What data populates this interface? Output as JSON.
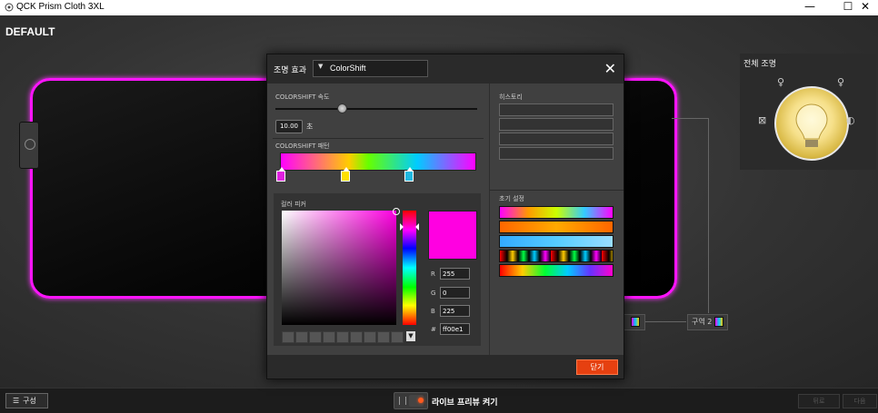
{
  "window": {
    "title": "QCK Prism Cloth 3XL",
    "minimize": "—",
    "maximize": "☐",
    "close": "✕"
  },
  "profile": {
    "name": "DEFAULT"
  },
  "global_lighting": {
    "label": "전체 조명"
  },
  "zone": {
    "label": "구역 2"
  },
  "dialog": {
    "title": "조명 효과",
    "effect_selected": "ColorShift",
    "close_icon": "✕",
    "speed_label": "COLORSHIFT 속도",
    "speed_value": "10.00",
    "speed_unit": "초",
    "speed_fraction": 0.33,
    "pattern_label": "COLORSHIFT 패턴",
    "pattern_stops": [
      {
        "color": "#e020e0"
      },
      {
        "color": "#ffe000"
      },
      {
        "color": "#20b8e0"
      }
    ],
    "color_picker_label": "컬러 피커",
    "rgb": {
      "r_label": "R",
      "r": "255",
      "g_label": "G",
      "g": "0",
      "b_label": "B",
      "b": "225",
      "hex_label": "#",
      "hex": "ff00e1"
    },
    "history_label": "히스토리",
    "presets_label": "초기 설정",
    "close_button": "닫기"
  },
  "bottom": {
    "config_label": "구성",
    "live_preview_label": "라이브 프리뷰 켜기",
    "back_btn": "뒤로",
    "next_btn": "다음"
  },
  "colors": {
    "accent": "#ff14ff",
    "button_orange": "#e64010",
    "selected_color": "#ff00e1"
  }
}
